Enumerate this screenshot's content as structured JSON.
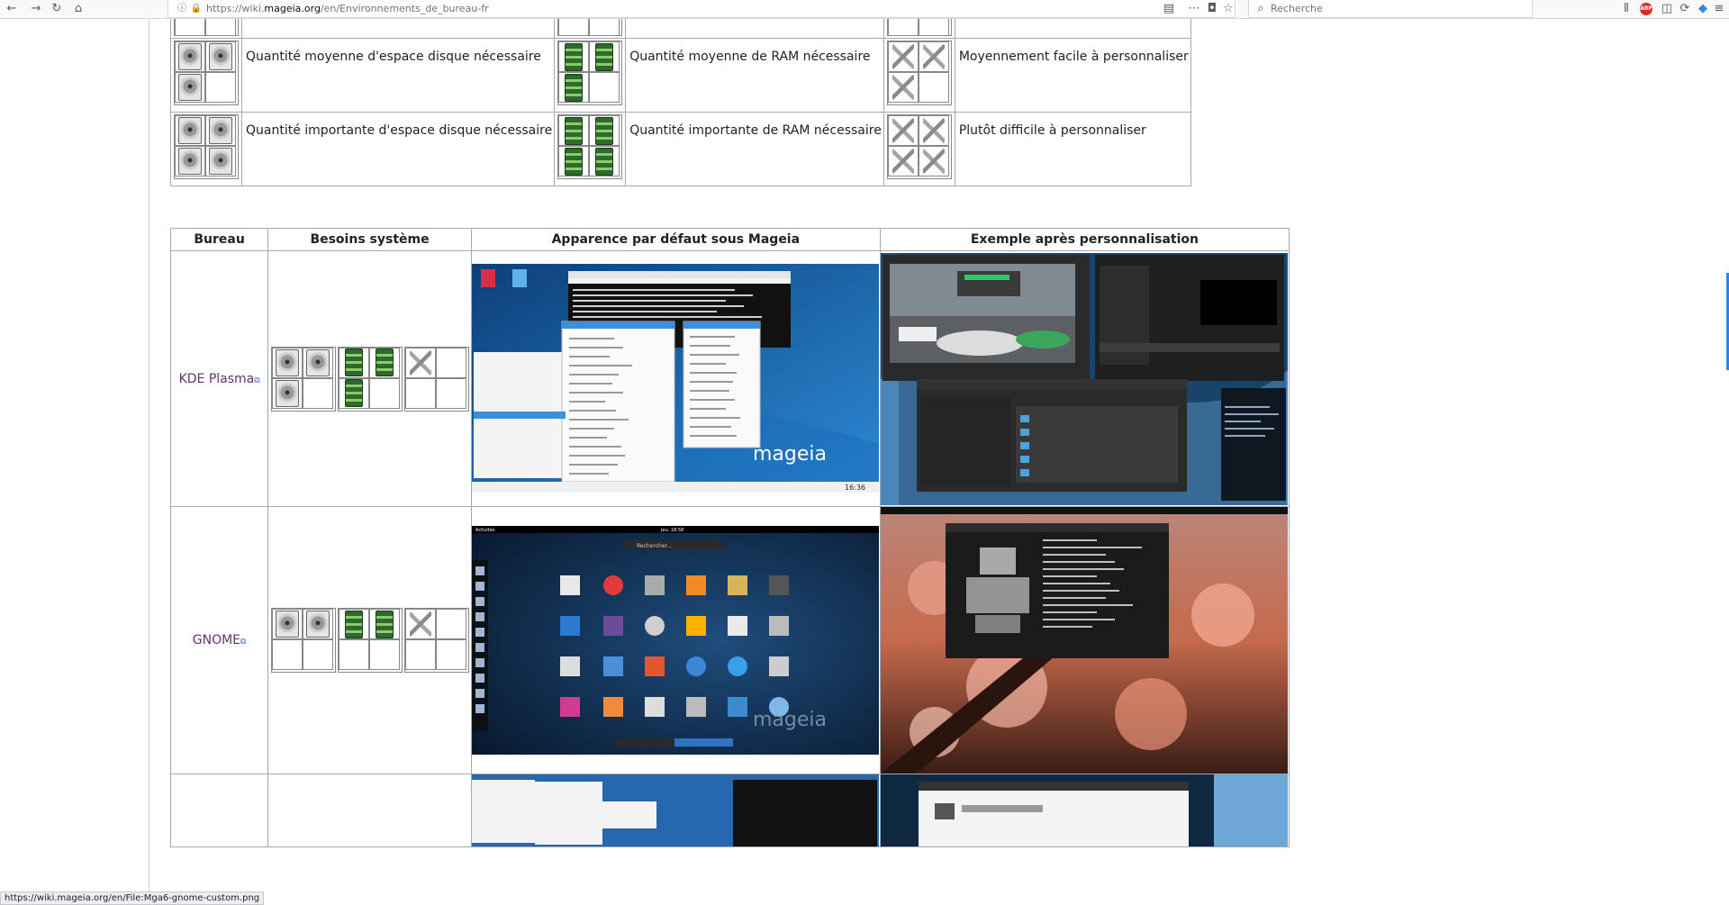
{
  "browser": {
    "url_prefix": "https://wiki.",
    "url_domain": "mageia.org",
    "url_path": "/en/Environnements_de_bureau-fr",
    "search_placeholder": "Recherche",
    "abp_badge": "ABP"
  },
  "legend_rows": [
    {
      "disk_text": "Quantité moyenne d'espace disque nécessaire",
      "ram_text": "Quantité moyenne de RAM nécessaire",
      "custom_text": "Moyennement facile à personnaliser",
      "disk_level": 3,
      "ram_level": 3,
      "custom_level": 3
    },
    {
      "disk_text": "Quantité importante d'espace disque nécessaire",
      "ram_text": "Quantité importante de RAM nécessaire",
      "custom_text": "Plutôt difficile à personnaliser",
      "disk_level": 4,
      "ram_level": 4,
      "custom_level": 4
    }
  ],
  "desktops_table": {
    "headers": [
      "Bureau",
      "Besoins système",
      "Apparence par défaut sous Mageia",
      "Exemple après personnalisation"
    ],
    "rows": [
      {
        "name": "KDE Plasma",
        "disk_level": 3,
        "ram_level": 3,
        "custom_level": 1,
        "default_logo": "mageia",
        "default_clock": "16:36"
      },
      {
        "name": "GNOME",
        "disk_level": 2,
        "ram_level": 2,
        "custom_level": 1,
        "default_logo": "mageia",
        "search_text": "Rechercher...",
        "top_date": "jeu. 18:58",
        "activities": "Activités"
      }
    ]
  },
  "status_url": "https://wiki.mageia.org/en/File:Mga6-gnome-custom.png"
}
